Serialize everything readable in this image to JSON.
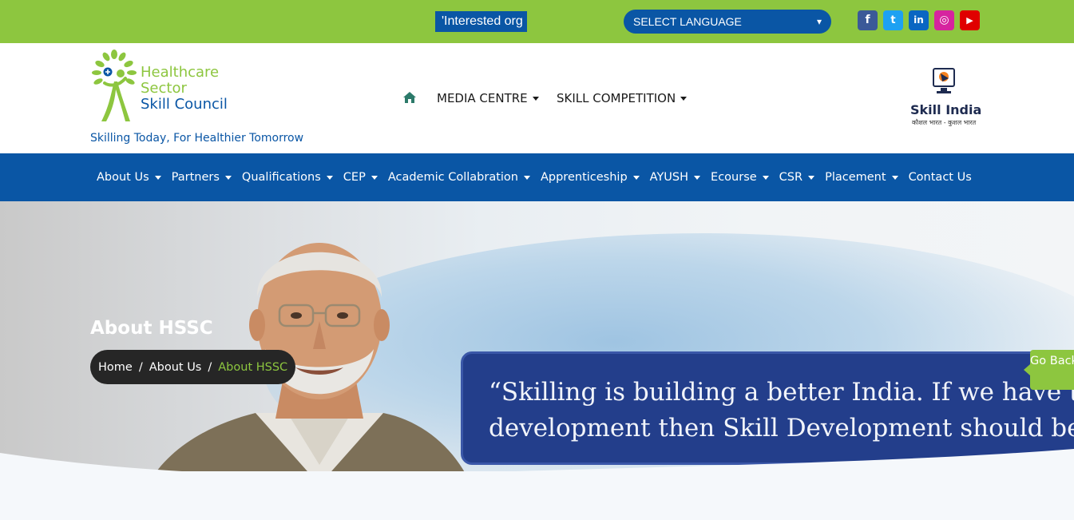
{
  "topbar": {
    "ticker_text": "'Interested org",
    "language_select": {
      "selected": "SELECT LANGUAGE",
      "caret_icon": "chevron-down-icon"
    },
    "social": [
      {
        "name": "facebook",
        "glyph": "f",
        "color": "#3b5998",
        "icon": "facebook-icon"
      },
      {
        "name": "twitter",
        "glyph": "t",
        "color": "#1da1f2",
        "icon": "twitter-icon"
      },
      {
        "name": "linkedin",
        "glyph": "in",
        "color": "#0a66c2",
        "icon": "linkedin-icon"
      },
      {
        "name": "instagram",
        "glyph": "◎",
        "color": "#d6249f",
        "icon": "instagram-icon"
      },
      {
        "name": "youtube",
        "glyph": "▶",
        "color": "#e00000",
        "icon": "youtube-icon"
      }
    ],
    "color": "#8dc63f"
  },
  "header": {
    "logo_line1": "Healthcare",
    "logo_line2": "Sector",
    "logo_line3": "Skill Council",
    "tagline": "Skilling Today, For Healthier Tomorrow",
    "nav": [
      {
        "label": "MEDIA CENTRE"
      },
      {
        "label": "SKILL COMPETITION"
      }
    ],
    "partner_logo": {
      "title": "Skill India",
      "subtitle": "कौशल भारत - कुशल भारत"
    }
  },
  "mainnav": {
    "color": "#0a56a5",
    "items": [
      {
        "label": "About Us",
        "dropdown": true
      },
      {
        "label": "Partners",
        "dropdown": true
      },
      {
        "label": "Qualifications",
        "dropdown": true
      },
      {
        "label": "CEP",
        "dropdown": true
      },
      {
        "label": "Academic Collabration",
        "dropdown": true
      },
      {
        "label": "Apprenticeship",
        "dropdown": true
      },
      {
        "label": "AYUSH",
        "dropdown": true
      },
      {
        "label": "Ecourse",
        "dropdown": true
      },
      {
        "label": "CSR",
        "dropdown": true
      },
      {
        "label": "Placement",
        "dropdown": true
      },
      {
        "label": "Contact Us",
        "dropdown": false
      }
    ]
  },
  "hero": {
    "title": "About HSSC",
    "breadcrumb": [
      "Home",
      "About Us",
      "About HSSC"
    ],
    "breadcrumb_separator": "/",
    "quote_line1": "“Skilling is building a better India. If we have to mo",
    "quote_line2": "development then Skill Development should be ou",
    "go_back": "Go Back",
    "accent_color": "#8dc63f"
  }
}
